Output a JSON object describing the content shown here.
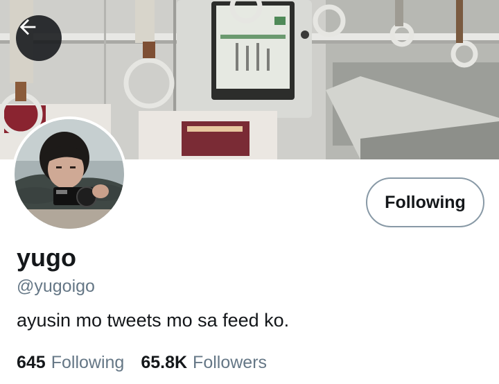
{
  "banner": {
    "alt": "profile banner photo of a train interior"
  },
  "back_button": {
    "icon": "arrow-left-icon"
  },
  "avatar": {
    "alt": "profile photo"
  },
  "follow_button": {
    "label": "Following"
  },
  "profile": {
    "display_name": "yugo",
    "handle": "@yugoigo",
    "bio": "ayusin mo tweets mo sa feed ko."
  },
  "stats": {
    "following_count": "645",
    "following_label": "Following",
    "followers_count": "65.8K",
    "followers_label": "Followers"
  },
  "colors": {
    "text_primary": "#14171a",
    "text_secondary": "#657786",
    "button_border": "#8899a6",
    "back_button_bg": "#14171a"
  }
}
